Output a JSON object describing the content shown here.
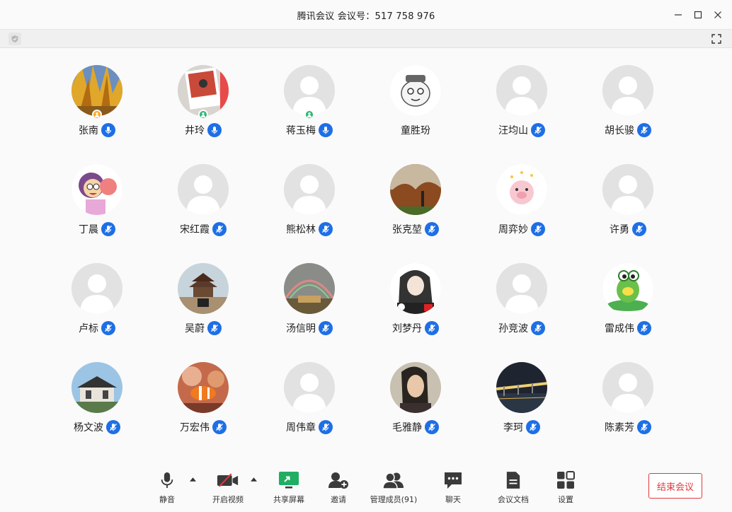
{
  "window": {
    "title": "腾讯会议 会议号：517 758 976"
  },
  "participants": [
    {
      "name": "张南",
      "avatar": "forest-photo",
      "role_icon": "host-icon",
      "mic": "on"
    },
    {
      "name": "井玲",
      "avatar": "polaroid-photo",
      "role_icon": "cohost-icon",
      "mic": "on"
    },
    {
      "name": "蒋玉梅",
      "avatar": "default",
      "role_icon": "cohost-icon",
      "mic": "on"
    },
    {
      "name": "童胜玢",
      "avatar": "cartoon-cat",
      "role_icon": "",
      "mic": "none"
    },
    {
      "name": "汪均山",
      "avatar": "default",
      "role_icon": "",
      "mic": "muted"
    },
    {
      "name": "胡长骏",
      "avatar": "default",
      "role_icon": "",
      "mic": "muted"
    },
    {
      "name": "丁晨",
      "avatar": "cartoon-girl",
      "role_icon": "",
      "mic": "muted"
    },
    {
      "name": "宋红霞",
      "avatar": "default",
      "role_icon": "",
      "mic": "muted"
    },
    {
      "name": "熊松林",
      "avatar": "default",
      "role_icon": "",
      "mic": "muted"
    },
    {
      "name": "张克堃",
      "avatar": "autumn-park-photo",
      "role_icon": "",
      "mic": "muted"
    },
    {
      "name": "周弈妙",
      "avatar": "cartoon-pig",
      "role_icon": "",
      "mic": "muted"
    },
    {
      "name": "许勇",
      "avatar": "default",
      "role_icon": "",
      "mic": "muted"
    },
    {
      "name": "卢标",
      "avatar": "default",
      "role_icon": "",
      "mic": "muted"
    },
    {
      "name": "吴蔚",
      "avatar": "pagoda-photo",
      "role_icon": "",
      "mic": "muted"
    },
    {
      "name": "汤信明",
      "avatar": "rainbow-photo",
      "role_icon": "",
      "mic": "muted"
    },
    {
      "name": "刘梦丹",
      "avatar": "drawing-girl",
      "role_icon": "",
      "mic": "muted"
    },
    {
      "name": "孙竞波",
      "avatar": "default",
      "role_icon": "",
      "mic": "muted"
    },
    {
      "name": "雷成伟",
      "avatar": "cartoon-frog",
      "role_icon": "",
      "mic": "muted"
    },
    {
      "name": "杨文波",
      "avatar": "house-photo",
      "role_icon": "",
      "mic": "muted"
    },
    {
      "name": "万宏伟",
      "avatar": "clownfish-photo",
      "role_icon": "",
      "mic": "muted"
    },
    {
      "name": "周伟章",
      "avatar": "default",
      "role_icon": "",
      "mic": "muted"
    },
    {
      "name": "毛雅静",
      "avatar": "portrait-photo",
      "role_icon": "",
      "mic": "muted"
    },
    {
      "name": "李珂",
      "avatar": "bridge-night-photo",
      "role_icon": "",
      "mic": "muted"
    },
    {
      "name": "陈素芳",
      "avatar": "default",
      "role_icon": "",
      "mic": "muted"
    }
  ],
  "toolbar": {
    "mute_label": "静音",
    "video_label": "开启视频",
    "share_label": "共享屏幕",
    "invite_label": "邀请",
    "members_label": "管理成员(91)",
    "chat_label": "聊天",
    "docs_label": "会议文档",
    "settings_label": "设置",
    "end_label": "结束会议"
  },
  "colors": {
    "mic_blue": "#1e6fe6",
    "end_red": "#e0393e",
    "share_green": "#1fae62",
    "host_orange": "#f5a623",
    "cohost_green": "#2bb673"
  }
}
